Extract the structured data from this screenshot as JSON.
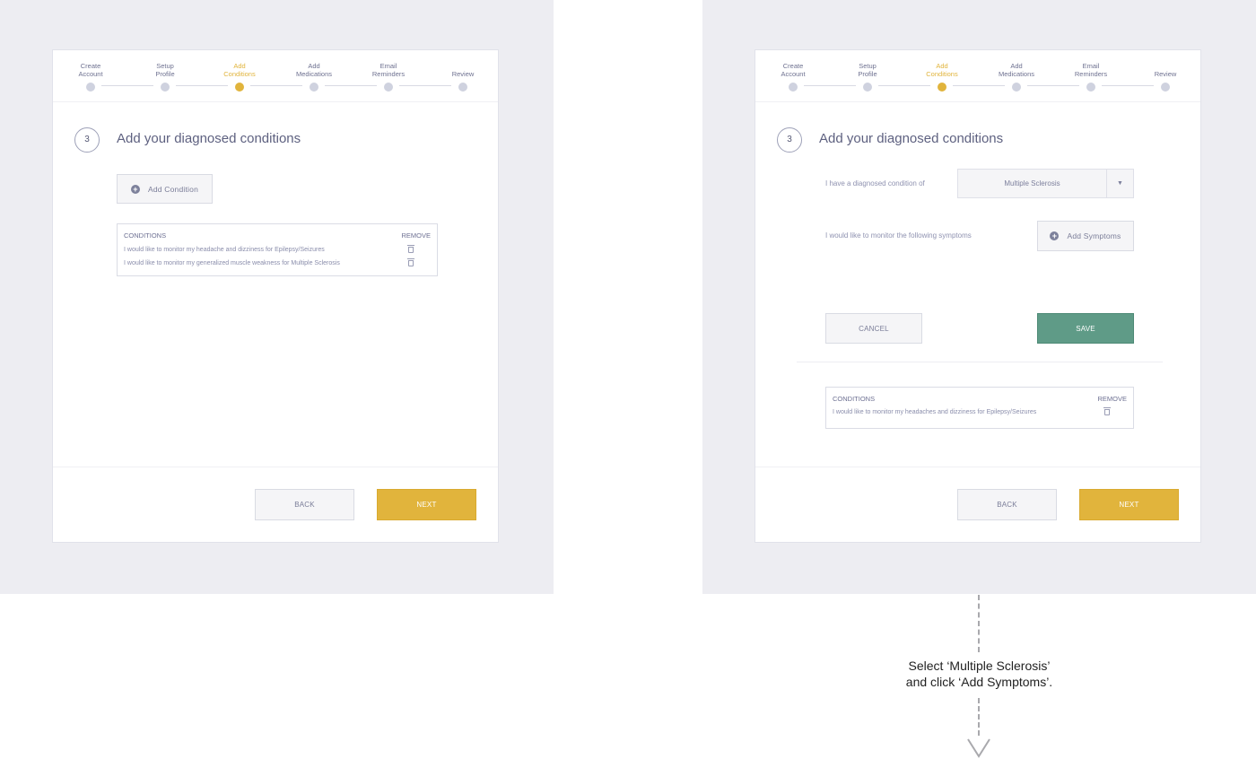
{
  "steps": [
    "Create\nAccount",
    "Setup\nProfile",
    "Add\nConditions",
    "Add\nMedications",
    "Email\nReminders",
    "Review"
  ],
  "active_step": 2,
  "left": {
    "step_number": "3",
    "title": "Add your diagnosed conditions",
    "add_condition_label": "Add Condition",
    "conditions": {
      "header": "CONDITIONS",
      "remove_header": "REMOVE",
      "rows": [
        "I would like to monitor my headache and dizziness for Epilepsy/Seizures",
        "I would like to monitor my generalized muscle weakness for Multiple Sclerosis"
      ]
    },
    "back_label": "BACK",
    "next_label": "NEXT"
  },
  "right": {
    "step_number": "3",
    "title": "Add your diagnosed conditions",
    "condition_label": "I have a diagnosed condition of",
    "condition_value": "Multiple Sclerosis",
    "dropdown_arrow": "▼",
    "symptoms_label": "I would like to monitor the following symptoms",
    "add_symptoms_label": "Add Symptoms",
    "cancel_label": "CANCEL",
    "save_label": "SAVE",
    "conditions": {
      "header": "CONDITIONS",
      "remove_header": "REMOVE",
      "rows": [
        "I would like to monitor my headaches and dizziness for Epilepsy/Seizures"
      ]
    },
    "back_label": "BACK",
    "next_label": "NEXT"
  },
  "annotation": {
    "line1": "Select ‘Multiple Sclerosis’",
    "line2": "and click ‘Add Symptoms’."
  },
  "colors": {
    "accent": "#e1b43c",
    "save": "#5f9b87",
    "canvas": "#ededf2"
  }
}
